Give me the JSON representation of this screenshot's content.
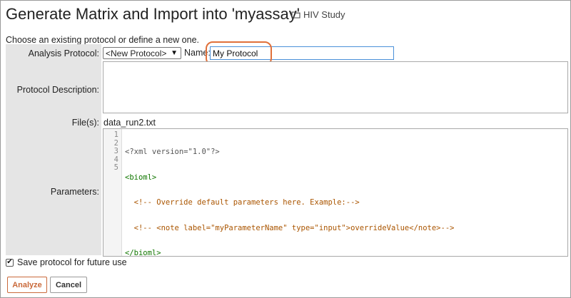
{
  "page": {
    "title": "Generate Matrix and Import into 'myassay'",
    "breadcrumb": "HIV Study",
    "intro": "Choose an existing protocol or define a new one."
  },
  "form": {
    "analysis_protocol_label": "Analysis Protocol:",
    "analysis_protocol_value": "<New Protocol>",
    "name_label": "Name:",
    "name_value": "My Protocol",
    "protocol_description_label": "Protocol Description:",
    "protocol_description_value": "",
    "files_label": "File(s):",
    "files_value": "data_run2.txt",
    "parameters_label": "Parameters:"
  },
  "editor": {
    "line_numbers": [
      "1",
      "2",
      "3",
      "4",
      "5"
    ],
    "lines": [
      "<?xml version=\"1.0\"?>",
      "<bioml>",
      "  <!-- Override default parameters here. Example:-->",
      "  <!-- <note label=\"myParameterName\" type=\"input\">overrideValue</note>-->",
      "</bioml>"
    ]
  },
  "save": {
    "label": "Save protocol for future use",
    "checked": true
  },
  "buttons": {
    "analyze": "Analyze",
    "cancel": "Cancel"
  },
  "colors": {
    "highlight": "#e0703a",
    "label_column": "#e5e5e5",
    "xml_tag": "#117700",
    "xml_comment": "#aa5500"
  },
  "icons": {
    "breadcrumb": "folder-icon",
    "select": "caret-down-icon",
    "save": "checkbox-checked-icon"
  }
}
